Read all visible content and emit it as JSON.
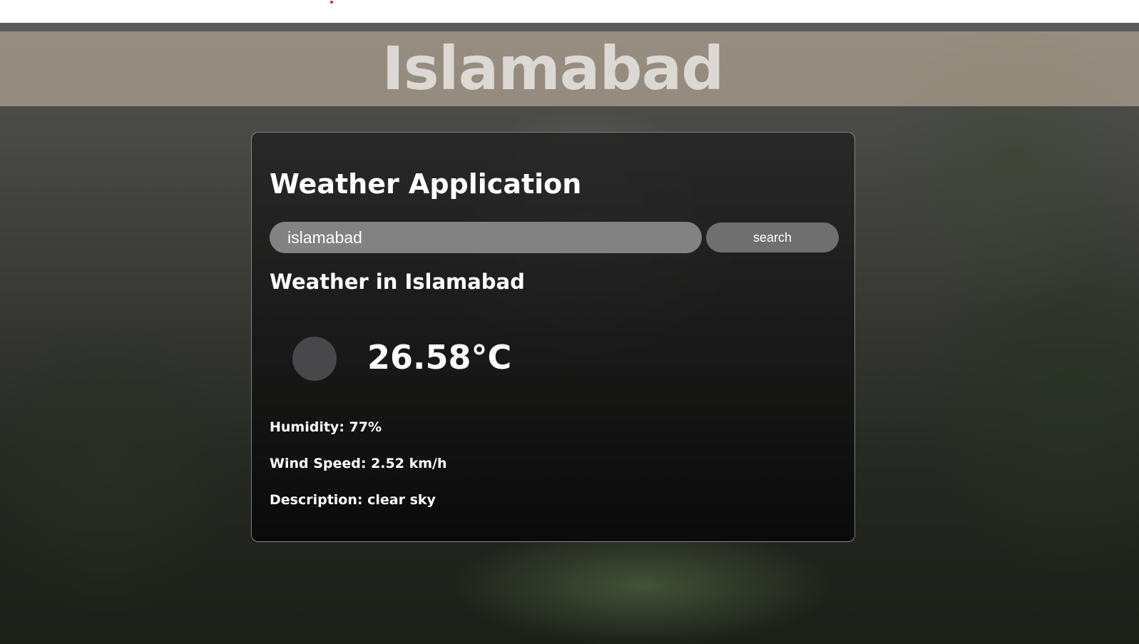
{
  "header": {
    "city": "Islamabad"
  },
  "card": {
    "title": "Weather Application",
    "search": {
      "value": "islamabad",
      "button_label": "search"
    },
    "weather_heading": "Weather in Islamabad",
    "icon": "weather-icon",
    "temperature": "26.58°C",
    "humidity": "Humidity: 77%",
    "wind_speed": "Wind Speed: 2.52 km/h",
    "description": "Description: clear sky"
  },
  "colors": {
    "header_band": "#b2a492",
    "search_input": "#828282",
    "search_button": "#6f6f6f",
    "text": "#ffffff"
  }
}
